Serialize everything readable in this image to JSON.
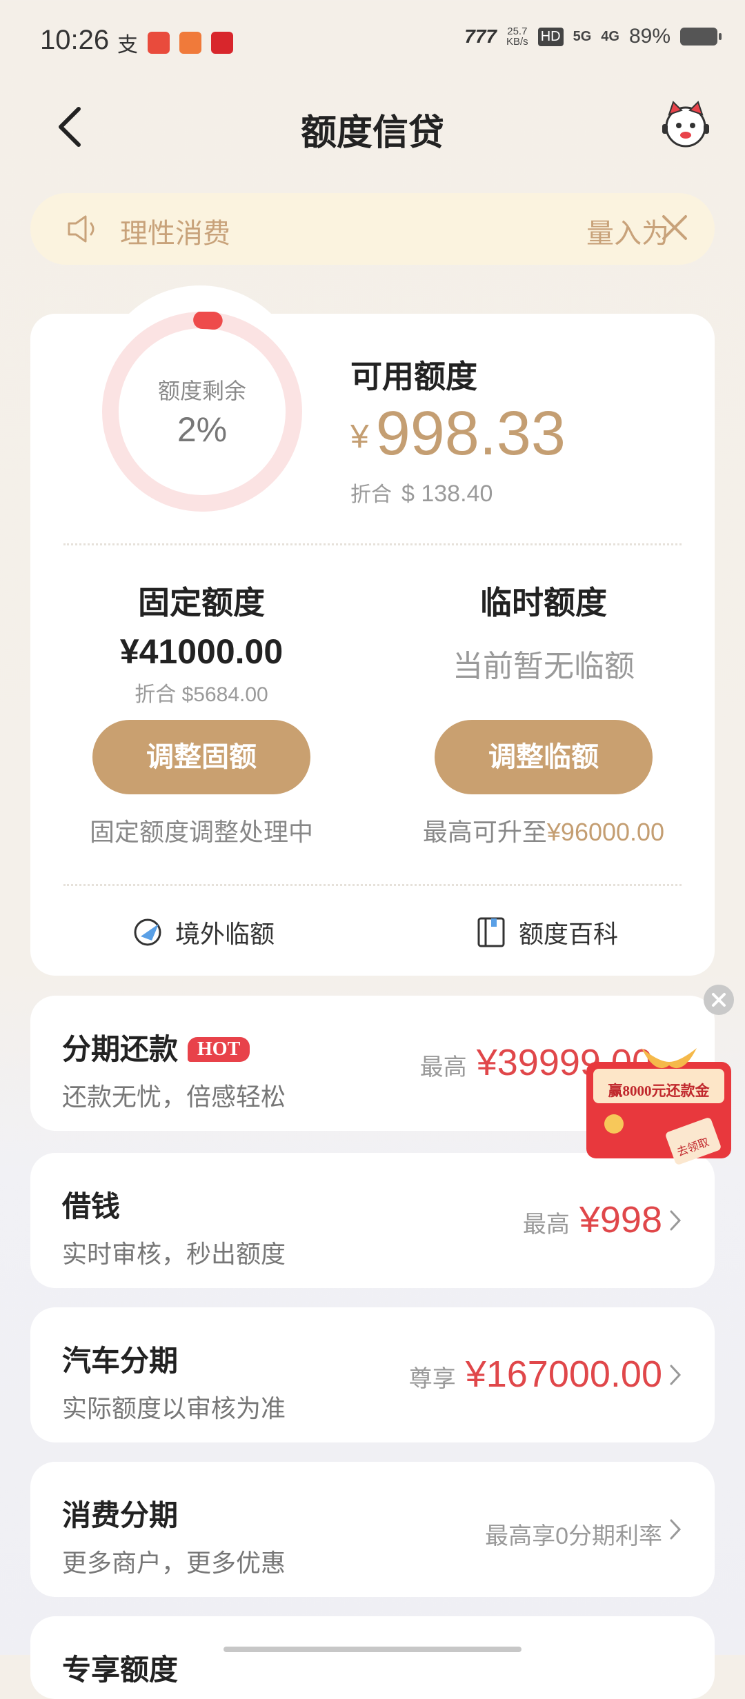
{
  "status_bar": {
    "time": "10:26",
    "net_speed_value": "25.7",
    "net_speed_unit": "KB/s",
    "hd": "HD",
    "signal1": "5G",
    "signal2": "4G",
    "battery": "89%"
  },
  "nav": {
    "title": "额度信贷",
    "back_icon": "back-arrow-icon",
    "mascot_icon": "cat-mascot-icon"
  },
  "notice": {
    "text_left": "理性消费",
    "text_right": "量入为"
  },
  "quota": {
    "ring_label": "额度剩余",
    "ring_percent": "2%",
    "ring_fraction": 0.02,
    "available_label": "可用额度",
    "currency": "¥",
    "available_amount": "998.33",
    "conv_prefix": "折合",
    "conv_amount": "$ 138.40"
  },
  "fixed": {
    "title": "固定额度",
    "amount": "¥41000.00",
    "conv": "折合 $5684.00",
    "button": "调整固额",
    "note": "固定额度调整处理中"
  },
  "temp": {
    "title": "临时额度",
    "none_text": "当前暂无临额",
    "button": "调整临额",
    "note_prefix": "最高可升至",
    "note_amount": "¥96000.00"
  },
  "links": {
    "overseas": "境外临额",
    "wiki": "额度百科"
  },
  "products": [
    {
      "title": "分期还款",
      "badge": "HOT",
      "subtitle": "还款无忧，倍感轻松",
      "prefix": "最高",
      "amount": "¥39999.00"
    },
    {
      "title": "借钱",
      "subtitle": "实时审核，秒出额度",
      "prefix": "最高",
      "amount": "¥998"
    },
    {
      "title": "汽车分期",
      "subtitle": "实际额度以审核为准",
      "prefix": "尊享",
      "amount": "¥167000.00"
    },
    {
      "title": "消费分期",
      "subtitle": "更多商户，更多优惠",
      "plain": "最高享0分期利率"
    },
    {
      "title": "专享额度"
    }
  ],
  "promo": {
    "text": "赢8000元还款金",
    "tag": "去领取"
  },
  "colors": {
    "accent": "#c9a070",
    "red": "#e0474a",
    "ring_bg": "#fbe3e3",
    "ring_fg": "#ee4b4b"
  }
}
